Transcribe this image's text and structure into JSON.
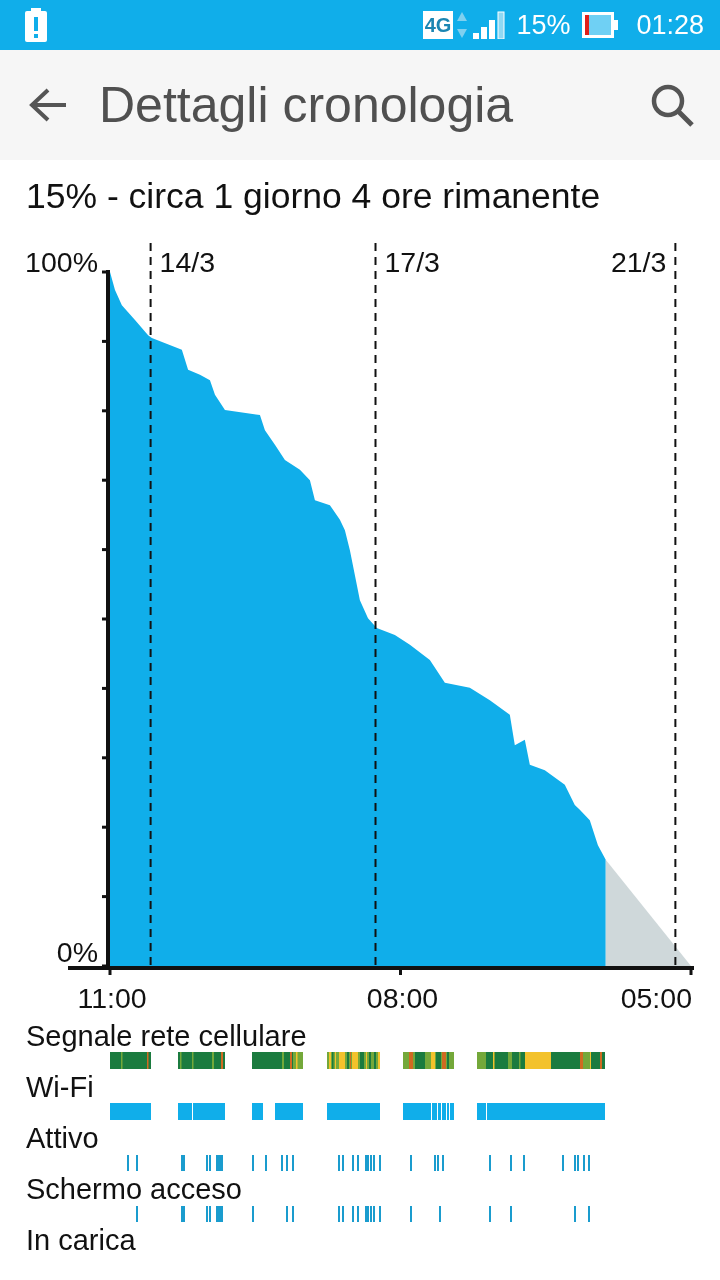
{
  "status_bar": {
    "network_type": "4G",
    "battery_percent": "15%",
    "time": "01:28"
  },
  "app_bar": {
    "title": "Dettagli cronologia"
  },
  "summary": "15% - circa 1 giorno 4 ore rimanente",
  "battery_chart": {
    "y_labels": [
      "100%",
      "0%"
    ],
    "date_labels": [
      "14/3",
      "17/3",
      "21/3"
    ],
    "time_labels": [
      "11:00",
      "08:00",
      "05:00"
    ]
  },
  "timelines": [
    {
      "label": "Segnale rete cellulare",
      "kind": "signal"
    },
    {
      "label": "Wi-Fi",
      "kind": "wifi"
    },
    {
      "label": "Attivo",
      "kind": "awake"
    },
    {
      "label": "Schermo acceso",
      "kind": "screen"
    },
    {
      "label": "In carica",
      "kind": "charging"
    }
  ]
}
